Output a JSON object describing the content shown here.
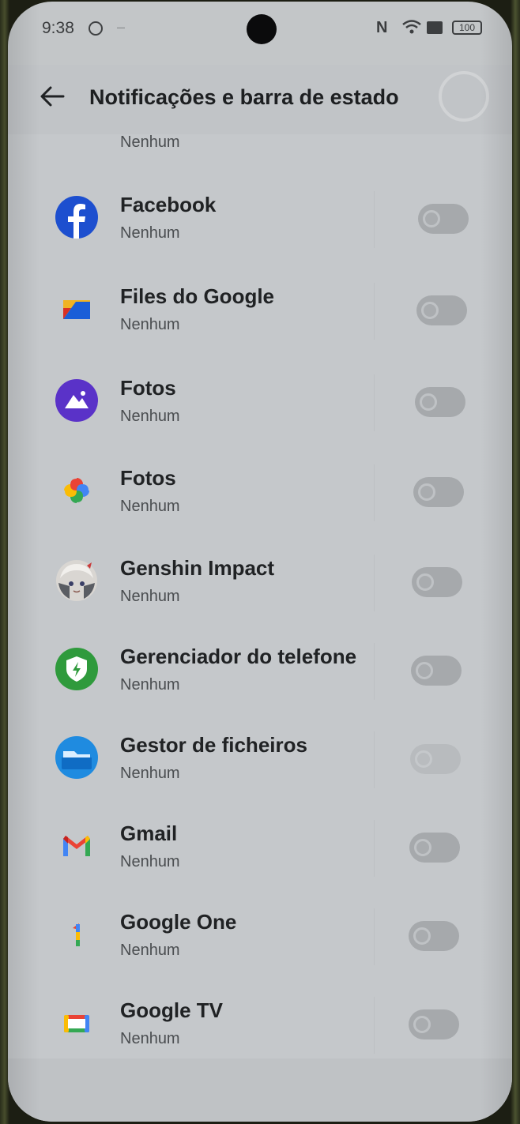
{
  "status_bar": {
    "time": "9:38",
    "dash": "–",
    "nfc": "N",
    "battery": "100",
    "icons": [
      "status-dot-icon",
      "nfc-icon",
      "wifi-icon",
      "sim-icon",
      "battery-icon"
    ]
  },
  "header": {
    "title": "Notificações e barra de estado",
    "back_icon": "back-arrow-icon"
  },
  "list": {
    "previous_subtitle": "Nenhum",
    "items": [
      {
        "name": "Facebook",
        "subtitle": "Nenhum",
        "icon": "facebook-icon",
        "enabled": false
      },
      {
        "name": "Files do Google",
        "subtitle": "Nenhum",
        "icon": "files-by-google-icon",
        "enabled": false
      },
      {
        "name": "Fotos",
        "subtitle": "Nenhum",
        "icon": "gallery-photos-icon",
        "enabled": false
      },
      {
        "name": "Fotos",
        "subtitle": "Nenhum",
        "icon": "google-photos-icon",
        "enabled": false
      },
      {
        "name": "Genshin Impact",
        "subtitle": "Nenhum",
        "icon": "genshin-impact-icon",
        "enabled": false
      },
      {
        "name": "Gerenciador do telefone",
        "subtitle": "Nenhum",
        "icon": "phone-manager-icon",
        "enabled": false
      },
      {
        "name": "Gestor de ficheiros",
        "subtitle": "Nenhum",
        "icon": "file-manager-icon",
        "enabled": false
      },
      {
        "name": "Gmail",
        "subtitle": "Nenhum",
        "icon": "gmail-icon",
        "enabled": false
      },
      {
        "name": "Google One",
        "subtitle": "Nenhum",
        "icon": "google-one-icon",
        "enabled": false
      },
      {
        "name": "Google TV",
        "subtitle": "Nenhum",
        "icon": "google-tv-icon",
        "enabled": false
      }
    ]
  },
  "colors": {
    "screen_background": "#c3c6c8",
    "toggle_off": "#a6a9ac",
    "facebook": "#1d4fcf",
    "gallery_photos": "#5a32c8",
    "phone_manager": "#2f9a3c",
    "file_manager": "#1f8be0"
  }
}
